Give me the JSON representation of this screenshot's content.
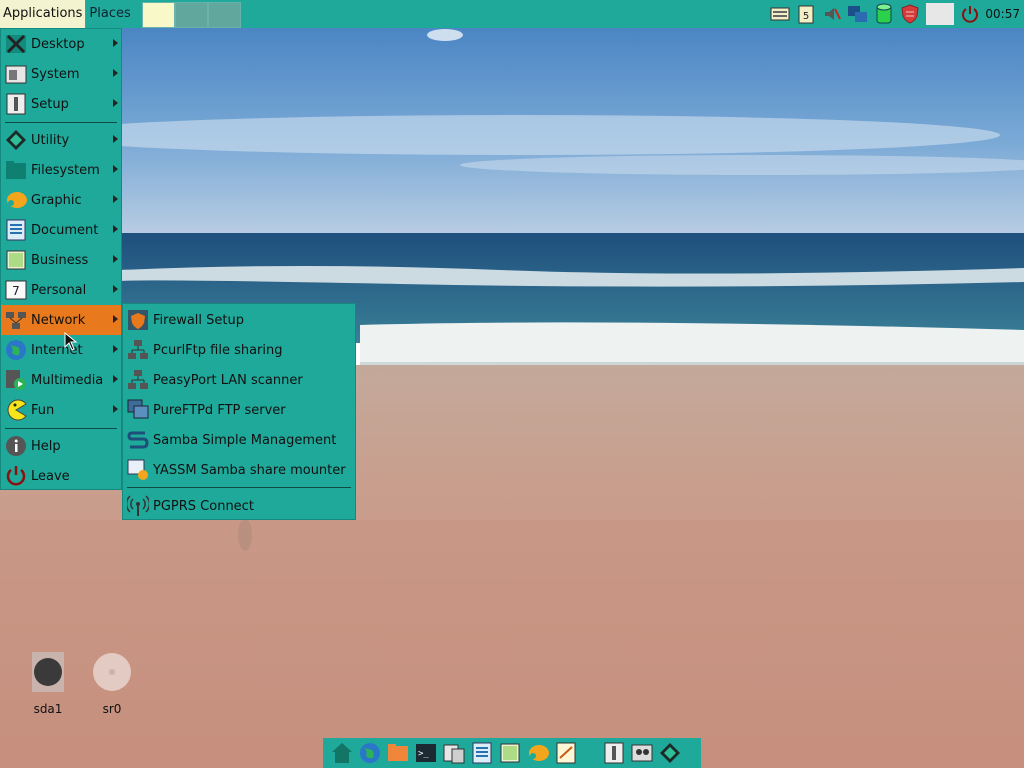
{
  "top_panel": {
    "applications_label": "Applications",
    "places_label": "Places",
    "clock": "00:57"
  },
  "apps_menu": {
    "items": [
      {
        "label": "Desktop",
        "icon": "desktop-icon"
      },
      {
        "label": "System",
        "icon": "system-icon"
      },
      {
        "label": "Setup",
        "icon": "setup-icon"
      },
      {
        "label": "Utility",
        "icon": "utility-icon"
      },
      {
        "label": "Filesystem",
        "icon": "folder-icon"
      },
      {
        "label": "Graphic",
        "icon": "graphic-icon"
      },
      {
        "label": "Document",
        "icon": "document-icon"
      },
      {
        "label": "Business",
        "icon": "spreadsheet-icon"
      },
      {
        "label": "Personal",
        "icon": "calendar-icon"
      },
      {
        "label": "Network",
        "icon": "network-icon"
      },
      {
        "label": "Internet",
        "icon": "globe-icon"
      },
      {
        "label": "Multimedia",
        "icon": "multimedia-icon"
      },
      {
        "label": "Fun",
        "icon": "pacman-icon"
      },
      {
        "label": "Help",
        "icon": "help-icon"
      },
      {
        "label": "Leave",
        "icon": "power-icon"
      }
    ],
    "personal_icon_text": "7"
  },
  "network_submenu": {
    "items": [
      {
        "label": "Firewall Setup",
        "icon": "firewall-icon"
      },
      {
        "label": "PcurlFtp file sharing",
        "icon": "network-share-icon"
      },
      {
        "label": "PeasyPort LAN scanner",
        "icon": "lan-scanner-icon"
      },
      {
        "label": "PureFTPd FTP server",
        "icon": "ftp-server-icon"
      },
      {
        "label": "Samba Simple Management",
        "icon": "samba-icon"
      },
      {
        "label": "YASSM Samba share mounter",
        "icon": "share-mounter-icon"
      },
      {
        "label": "PGPRS Connect",
        "icon": "antenna-icon"
      }
    ]
  },
  "desktop": {
    "drives": [
      {
        "label": "sda1",
        "icon": "hard-drive-icon"
      },
      {
        "label": "sr0",
        "icon": "optical-drive-icon"
      }
    ]
  },
  "colors": {
    "panel": "#1fa99a",
    "highlight": "#e8791c",
    "sky": "#5d93c8",
    "sea": "#2b6a8e",
    "sand": "#c59a8b"
  }
}
